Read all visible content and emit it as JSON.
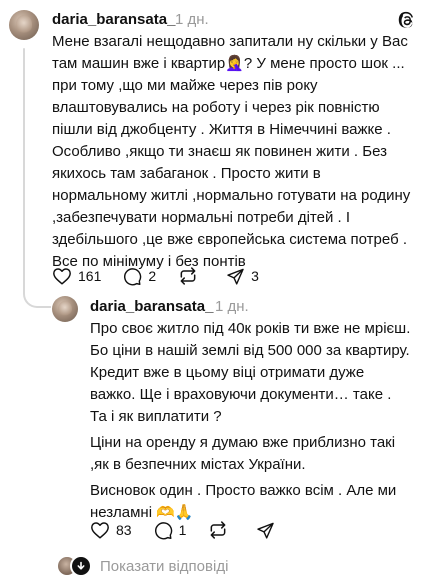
{
  "post": {
    "username": "daria_baransata_",
    "time": "1 дн.",
    "text": "Мене взагалі нещодавно запитали ну скільки у Вас там машин вже і квартир🤦‍♀️? У мене просто шок ... при тому ,що ми майже через пів року влаштовувались на роботу і через рік повністю пішли від джобценту . Життя в Німеччині важке . Особливо ,якщо ти знаєш як повинен жити . Без якихось там забаганок . Просто жити в нормальному житлі ,нормально готувати на родину ,забезпечувати нормальні потреби дітей . І здебільшого ,це вже європейська система потреб . Все по мінімуму і без понтів",
    "likes": "161",
    "comments": "2",
    "reposts": "3"
  },
  "reply": {
    "username": "daria_baransata_",
    "time": "1 дн.",
    "paragraphs": [
      "Про своє житло під 40к років ти вже не мрієш. Бо ціни в нашій землі від 500 000 за квартиру. Кредит вже в цьому віці отримати дуже важко. Ще і враховуючи документи… таке . Та і як виплатити ?",
      "Ціни на оренду я думаю вже приблизно такі ,як в безпечних містах України.",
      "Висновок один . Просто важко всім . Але ми незламні 🫶🙏"
    ],
    "likes": "83",
    "comments": "1"
  },
  "footer": {
    "show_replies_label": "Показати відповіді"
  },
  "icons": {
    "app_logo": "threads-logo-icon",
    "like": "heart-icon",
    "comment": "comment-bubble-icon",
    "repost": "repost-icon",
    "share": "send-icon"
  }
}
